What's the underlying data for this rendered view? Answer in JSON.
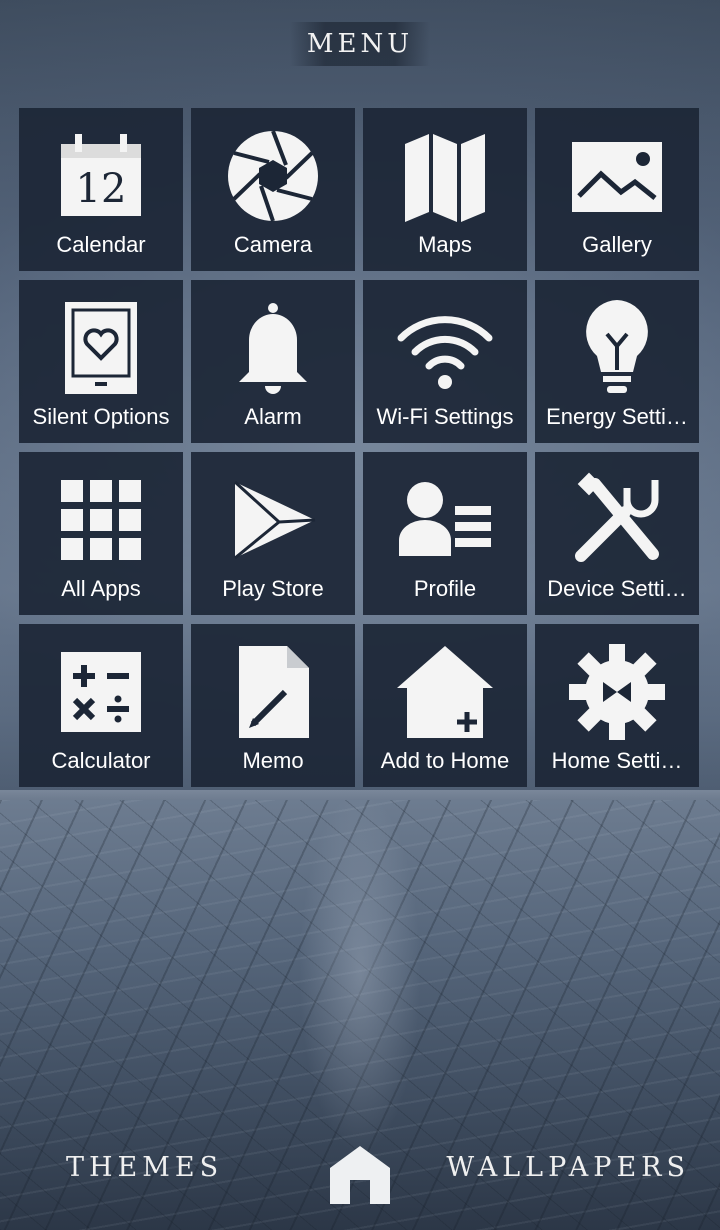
{
  "header": {
    "title": "MENU"
  },
  "apps": [
    {
      "label": "Calendar",
      "icon": "calendar-icon",
      "day": "12"
    },
    {
      "label": "Camera",
      "icon": "camera-shutter-icon"
    },
    {
      "label": "Maps",
      "icon": "map-icon"
    },
    {
      "label": "Gallery",
      "icon": "gallery-image-icon"
    },
    {
      "label": "Silent Options",
      "icon": "tablet-heart-icon"
    },
    {
      "label": "Alarm",
      "icon": "bell-icon"
    },
    {
      "label": "Wi-Fi Settings",
      "icon": "wifi-icon"
    },
    {
      "label": "Energy Setti…",
      "icon": "lightbulb-icon"
    },
    {
      "label": "All Apps",
      "icon": "grid-icon"
    },
    {
      "label": "Play Store",
      "icon": "play-store-icon"
    },
    {
      "label": "Profile",
      "icon": "profile-card-icon"
    },
    {
      "label": "Device Setti…",
      "icon": "tools-icon"
    },
    {
      "label": "Calculator",
      "icon": "calculator-icon"
    },
    {
      "label": "Memo",
      "icon": "memo-pencil-icon"
    },
    {
      "label": "Add to Home",
      "icon": "house-plus-icon"
    },
    {
      "label": "Home Setti…",
      "icon": "gear-icon"
    }
  ],
  "footer": {
    "themes_label": "THEMES",
    "wallpapers_label": "WALLPAPERS",
    "home_icon": "home-icon"
  },
  "colors": {
    "tile_bg": "#1c2636",
    "icon_fill": "#f4f4f4"
  }
}
